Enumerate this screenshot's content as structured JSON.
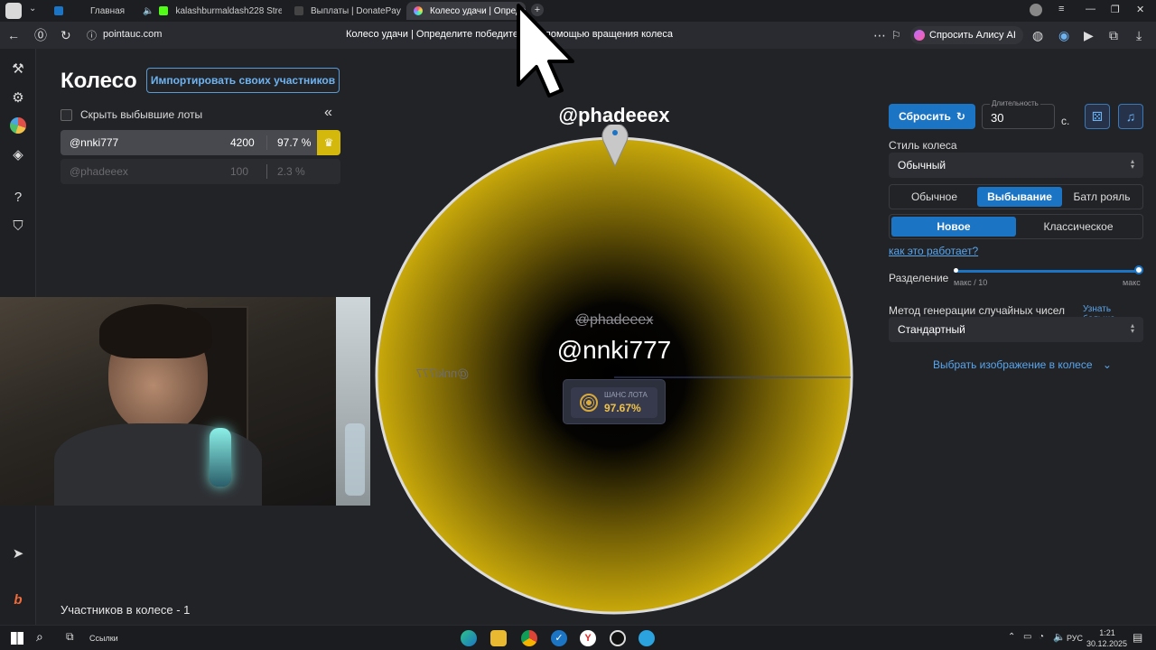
{
  "browser": {
    "tabs": [
      {
        "label": "Главная",
        "color": "#1c74c4"
      },
      {
        "label": "kalashburmaldash228 Stre",
        "color": "#53fc18"
      },
      {
        "label": "Выплаты | DonatePay",
        "color": "#2b2b2b"
      },
      {
        "label": "Колесо удачи | Опреде",
        "color": "#b86cff",
        "active": true
      }
    ],
    "url": "pointauc.com",
    "page_title": "Колесо удачи | Определите победителей с помощью вращения колеса",
    "alice_label": "Спросить Алису AI"
  },
  "left": {
    "heading": "Колесо",
    "import_button": "Импортировать своих участников",
    "hide_checkbox_label": "Скрыть выбывшие лоты",
    "collapse_icon": "«",
    "lots": [
      {
        "name": "@nnki777",
        "amount": "4200",
        "percent": "97.7 %",
        "active": true
      },
      {
        "name": "@phadeeex",
        "amount": "100",
        "percent": "2.3 %",
        "active": false
      }
    ],
    "participants_count": "Участников в колесе - 1"
  },
  "wheel": {
    "winner_top": "@phadeeex",
    "center_eliminated": "@phadeeex",
    "center_name": "@nnki777",
    "slice_label_mirrored": "@nnki777",
    "chance_label": "ШАНС ЛОТА",
    "chance_value": "97.67%",
    "color": "#c9a90b"
  },
  "controls": {
    "reset_button": "Сбросить",
    "duration_label": "Длительность",
    "duration_value": "30",
    "seconds_unit": "с.",
    "wheel_style_label": "Стиль колеса",
    "wheel_style_value": "Обычный",
    "modes": [
      {
        "label": "Обычное",
        "active": false
      },
      {
        "label": "Выбывание",
        "active": true
      },
      {
        "label": "Батл рояль",
        "active": false
      }
    ],
    "variants": [
      {
        "label": "Новое",
        "active": true
      },
      {
        "label": "Классическое",
        "active": false
      }
    ],
    "how_it_works_link": "как это работает?",
    "split_label": "Разделение",
    "split_min_label": "макс / 10",
    "split_max_label": "макс",
    "split_value_fraction": 1.0,
    "rng_label": "Метод генерации случайных чисел",
    "learn_more_link": "Узнать больше",
    "rng_value": "Стандартный",
    "choose_image_label": "Выбрать изображение в колесе"
  },
  "taskbar": {
    "links_label": "Ссылки",
    "lang": "РУС",
    "time": "1:21",
    "date": "30.12.2025"
  }
}
